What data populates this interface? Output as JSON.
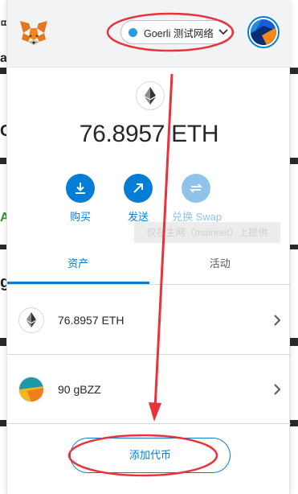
{
  "background": {
    "left_letters": [
      "ㄸ",
      "a",
      "G",
      "A",
      "g"
    ]
  },
  "header": {
    "network_name": "Goerli 测试网络"
  },
  "balance": {
    "amount": "76.8957 ETH"
  },
  "actions": {
    "buy": "购买",
    "send": "发送",
    "swap": "兑换 Swap"
  },
  "tooltip": {
    "text": "仅在主网（mainnet）上提供"
  },
  "tabs": {
    "assets": "资产",
    "activity": "活动"
  },
  "assets": [
    {
      "label": "76.8957 ETH"
    },
    {
      "label": "90 gBZZ"
    }
  ],
  "add_token": {
    "label": "添加代币"
  },
  "colors": {
    "accent": "#037dd6",
    "annotation": "#e8323c",
    "network_dot": "#2a9be9"
  }
}
